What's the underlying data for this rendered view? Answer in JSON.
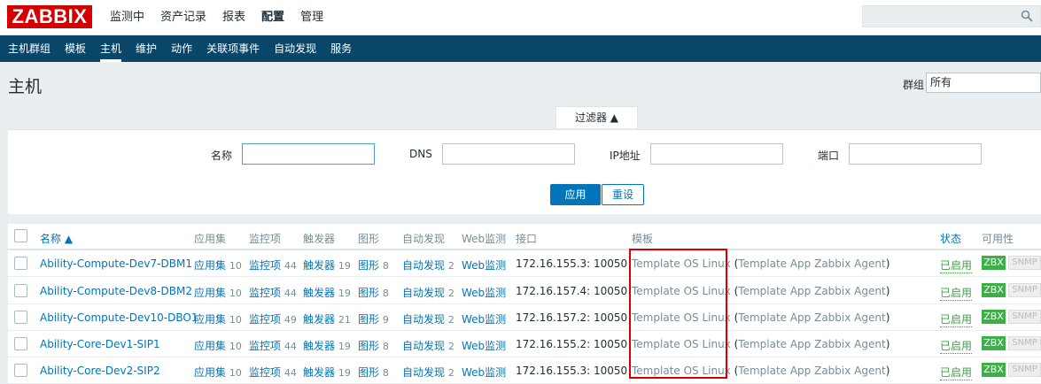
{
  "logo": "ZABBIX",
  "main_menu": [
    "监测中",
    "资产记录",
    "报表",
    "配置",
    "管理"
  ],
  "main_menu_active": "配置",
  "sub_menu": [
    "主机群组",
    "模板",
    "主机",
    "维护",
    "动作",
    "关联项事件",
    "自动发现",
    "服务"
  ],
  "sub_menu_active": "主机",
  "page_title": "主机",
  "group_filter": {
    "label": "群组",
    "value": "所有"
  },
  "filter": {
    "tab_label": "过滤器 ▲",
    "name_label": "名称",
    "dns_label": "DNS",
    "ip_label": "IP地址",
    "port_label": "端口",
    "apply_label": "应用",
    "reset_label": "重设"
  },
  "table": {
    "headers": {
      "name": "名称 ▲",
      "applications": "应用集",
      "items": "监控项",
      "triggers": "触发器",
      "graphs": "图形",
      "discovery": "自动发现",
      "web": "Web监测",
      "interface": "接口",
      "templates": "模板",
      "status": "状态",
      "availability": "可用性"
    },
    "rows": [
      {
        "name": "Ability-Compute-Dev7-DBM1",
        "app_label": "应用集",
        "app_count": "10",
        "items_label": "监控项",
        "items_count": "44",
        "triggers_label": "触发器",
        "triggers_count": "19",
        "graphs_label": "图形",
        "graphs_count": "8",
        "disc_label": "自动发现",
        "disc_count": "2",
        "web_label": "Web监测",
        "interface": "172.16.155.3: 10050",
        "tpl1": "Template OS Linux",
        "tpl2_open": " (",
        "tpl2": "Template App Zabbix Agent",
        "tpl2_close": ")",
        "status": "已启用",
        "zbx": "ZBX",
        "snmp": "SNMP"
      },
      {
        "name": "Ability-Compute-Dev8-DBM2",
        "app_label": "应用集",
        "app_count": "10",
        "items_label": "监控项",
        "items_count": "44",
        "triggers_label": "触发器",
        "triggers_count": "19",
        "graphs_label": "图形",
        "graphs_count": "8",
        "disc_label": "自动发现",
        "disc_count": "2",
        "web_label": "Web监测",
        "interface": "172.16.157.4: 10050",
        "tpl1": "Template OS Linux",
        "tpl2_open": " (",
        "tpl2": "Template App Zabbix Agent",
        "tpl2_close": ")",
        "status": "已启用",
        "zbx": "ZBX",
        "snmp": "SNMP"
      },
      {
        "name": "Ability-Compute-Dev10-DBO1",
        "app_label": "应用集",
        "app_count": "10",
        "items_label": "监控项",
        "items_count": "49",
        "triggers_label": "触发器",
        "triggers_count": "21",
        "graphs_label": "图形",
        "graphs_count": "9",
        "disc_label": "自动发现",
        "disc_count": "2",
        "web_label": "Web监测",
        "interface": "172.16.157.2: 10050",
        "tpl1": "Template OS Linux",
        "tpl2_open": " (",
        "tpl2": "Template App Zabbix Agent",
        "tpl2_close": ")",
        "status": "已启用",
        "zbx": "ZBX",
        "snmp": "SNMP"
      },
      {
        "name": "Ability-Core-Dev1-SIP1",
        "app_label": "应用集",
        "app_count": "10",
        "items_label": "监控项",
        "items_count": "44",
        "triggers_label": "触发器",
        "triggers_count": "19",
        "graphs_label": "图形",
        "graphs_count": "8",
        "disc_label": "自动发现",
        "disc_count": "2",
        "web_label": "Web监测",
        "interface": "172.16.155.2: 10050",
        "tpl1": "Template OS Linux",
        "tpl2_open": " (",
        "tpl2": "Template App Zabbix Agent",
        "tpl2_close": ")",
        "status": "已启用",
        "zbx": "ZBX",
        "snmp": "SNMP"
      },
      {
        "name": "Ability-Core-Dev2-SIP2",
        "app_label": "应用集",
        "app_count": "10",
        "items_label": "监控项",
        "items_count": "44",
        "triggers_label": "触发器",
        "triggers_count": "19",
        "graphs_label": "图形",
        "graphs_count": "8",
        "disc_label": "自动发现",
        "disc_count": "2",
        "web_label": "Web监测",
        "interface": "172.16.155.3: 10050",
        "tpl1": "Template OS Linux",
        "tpl2_open": " (",
        "tpl2": "Template App Zabbix Agent",
        "tpl2_close": ")",
        "status": "已启用",
        "zbx": "ZBX",
        "snmp": "SNMP"
      }
    ]
  },
  "colors": {
    "accent": "#0275b8",
    "nav": "#0a466a",
    "logo": "#d40000",
    "enabled": "#429e47",
    "highlight": "#d90000"
  }
}
